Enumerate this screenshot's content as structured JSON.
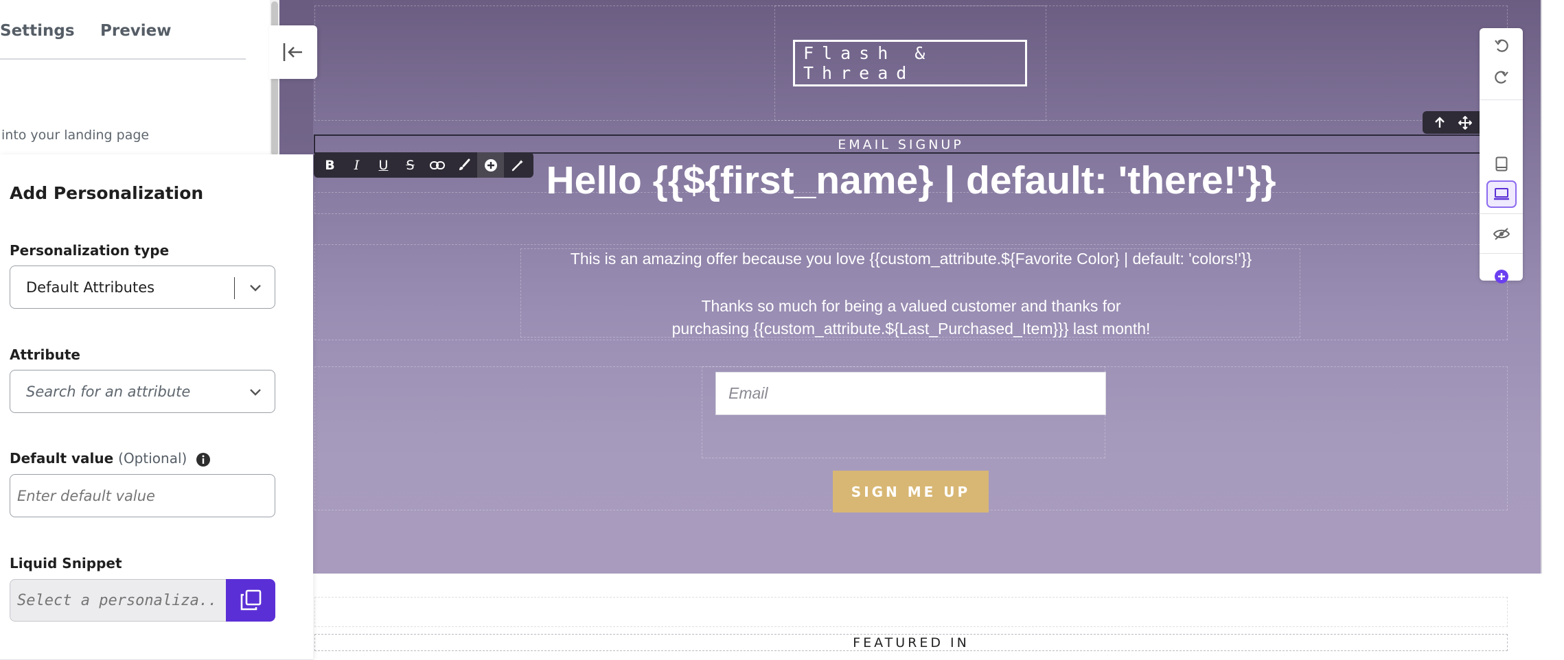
{
  "panel_tabs": {
    "settings": "Settings",
    "preview": "Preview"
  },
  "intro_text": "into your landing page",
  "personalization": {
    "title": "Add Personalization",
    "type_label": "Personalization type",
    "type_value": "Default Attributes",
    "attribute_label": "Attribute",
    "attribute_placeholder": "Search for an attribute",
    "default_label": "Default value",
    "default_optional": "(Optional)",
    "default_placeholder": "Enter default value",
    "liquid_label": "Liquid Snippet",
    "liquid_placeholder": "Select a personaliza..."
  },
  "page": {
    "logo": "Flash & Thread",
    "signup_label": "EMAIL SIGNUP",
    "heading": "Hello {{${first_name} | default: 'there!'}}",
    "para1": "This is an amazing offer because you love {{custom_attribute.${Favorite Color} | default: 'colors!'}}",
    "para2_line1": "Thanks so much for being a valued customer and thanks for",
    "para2_line2": "purchasing {{custom_attribute.${Last_Purchased_Item}}} last month!",
    "email_placeholder": "Email",
    "button_label": "SIGN ME UP",
    "featured_label": "FEATURED IN"
  },
  "format_toolbar": [
    {
      "name": "bold",
      "glyph": "B"
    },
    {
      "name": "italic",
      "glyph": "I"
    },
    {
      "name": "underline",
      "glyph": "U"
    },
    {
      "name": "strikethrough",
      "glyph": "S"
    }
  ],
  "colors": {
    "accent": "#5b2fd6",
    "button": "#d8b774",
    "hero_top": "#6b5d82",
    "hero_bottom": "#a89bbd",
    "toolbar": "#2e2b36"
  }
}
